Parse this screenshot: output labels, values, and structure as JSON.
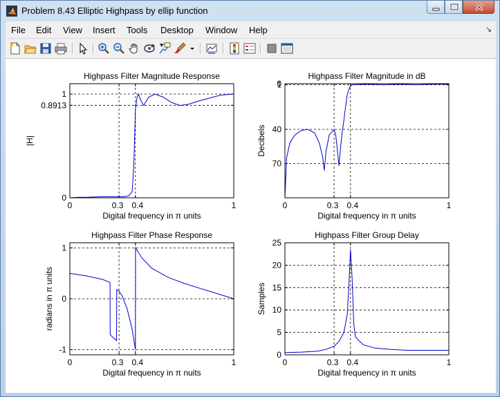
{
  "window": {
    "title": "Problem 8.43 Elliptic Highpass by ellip function"
  },
  "menu": [
    "File",
    "Edit",
    "View",
    "Insert",
    "Tools",
    "Desktop",
    "Window",
    "Help"
  ],
  "menu_overflow": "↘",
  "toolbar_icons": [
    "new-figure-icon",
    "open-file-icon",
    "save-icon",
    "print-icon",
    "edit-plot-icon",
    "zoom-in-icon",
    "zoom-out-icon",
    "pan-icon",
    "rotate-3d-icon",
    "data-cursor-icon",
    "brush-icon",
    "brush-dropdown-icon",
    "link-plot-icon",
    "colorbar-icon",
    "legend-icon",
    "hide-plot-tools-icon",
    "show-plot-tools-icon"
  ],
  "colors": {
    "line": "#0000cc",
    "axes": "#000000",
    "background": "#ffffff"
  },
  "chart_data": [
    {
      "type": "line",
      "title": "Highpass Filter Magnitude Response",
      "xlabel": "Digital frequency in π units",
      "ylabel": "|H|",
      "xlim": [
        0,
        1
      ],
      "ylim": [
        0,
        1.1
      ],
      "xticks": [
        "0",
        "0.3",
        "0.4",
        "1"
      ],
      "xtick_values": [
        0,
        0.3,
        0.4,
        1
      ],
      "yticks": [
        "0",
        "0.8913",
        "1"
      ],
      "ytick_values": [
        0,
        0.8913,
        1
      ],
      "grid": "dashed at ticks",
      "x": [
        0,
        0.05,
        0.1,
        0.15,
        0.2,
        0.25,
        0.3,
        0.33,
        0.36,
        0.38,
        0.39,
        0.4,
        0.41,
        0.42,
        0.43,
        0.45,
        0.48,
        0.52,
        0.57,
        0.62,
        0.67,
        0.72,
        0.78,
        0.85,
        0.92,
        1.0
      ],
      "y": [
        0,
        0.005,
        0.005,
        0.008,
        0.01,
        0.01,
        0.01,
        0.01,
        0.02,
        0.06,
        0.3,
        0.85,
        0.97,
        1.0,
        0.95,
        0.89,
        0.97,
        1.0,
        0.97,
        0.92,
        0.89,
        0.9,
        0.93,
        0.96,
        0.99,
        1.0
      ]
    },
    {
      "type": "line",
      "title": "Highpass Filter Magnitude in dB",
      "xlabel": "Digital frequency in π units",
      "ylabel": "Decibels",
      "xlim": [
        0,
        1
      ],
      "ylim": [
        -100,
        0
      ],
      "y_display": "attenuation axis reversed (0 at top)",
      "xticks": [
        "0",
        "0.3",
        "0.4",
        "1"
      ],
      "xtick_values": [
        0,
        0.3,
        0.4,
        1
      ],
      "yticks": [
        "0",
        "1",
        "40",
        "70"
      ],
      "ytick_values": [
        0,
        1,
        40,
        70
      ],
      "grid": "dashed at ticks",
      "x": [
        0,
        0.01,
        0.03,
        0.06,
        0.1,
        0.14,
        0.18,
        0.21,
        0.23,
        0.24,
        0.25,
        0.27,
        0.3,
        0.31,
        0.33,
        0.34,
        0.35,
        0.36,
        0.37,
        0.38,
        0.39,
        0.4,
        0.41,
        0.5,
        0.6,
        0.7,
        0.8,
        0.9,
        1.0
      ],
      "y": [
        -100,
        -65,
        -52,
        -45,
        -41,
        -40,
        -43,
        -52,
        -64,
        -76,
        -60,
        -45,
        -40,
        -45,
        -72,
        -55,
        -42,
        -32,
        -20,
        -10,
        -5,
        -2,
        -1,
        -0.5,
        -1,
        -0.5,
        -1,
        -0.5,
        -0.5
      ]
    },
    {
      "type": "line",
      "title": "Highpass Filter Phase Response",
      "xlabel": "Digital frequency in π nuits",
      "ylabel": "radians in π units",
      "xlim": [
        0,
        1
      ],
      "ylim": [
        -1.1,
        1.1
      ],
      "xticks": [
        "0",
        "0.3",
        "0.4",
        "1"
      ],
      "xtick_values": [
        0,
        0.3,
        0.4,
        1
      ],
      "yticks": [
        "-1",
        "0",
        "1"
      ],
      "ytick_values": [
        -1,
        0,
        1
      ],
      "grid": "dashed at ticks",
      "x": [
        0,
        0.1,
        0.2,
        0.245,
        0.246,
        0.25,
        0.285,
        0.286,
        0.3,
        0.32,
        0.35,
        0.38,
        0.4,
        0.401,
        0.44,
        0.5,
        0.6,
        0.7,
        0.8,
        0.9,
        1.0
      ],
      "y": [
        0.5,
        0.45,
        0.38,
        0.32,
        -0.7,
        -0.72,
        -0.82,
        0.18,
        0.15,
        0.05,
        -0.2,
        -0.6,
        -1.0,
        1.0,
        0.8,
        0.6,
        0.42,
        0.3,
        0.2,
        0.1,
        0.0
      ]
    },
    {
      "type": "line",
      "title": "Highpass Filter Group Delay",
      "xlabel": "Digital frequency in π units",
      "ylabel": "Samples",
      "xlim": [
        0,
        1
      ],
      "ylim": [
        0,
        25
      ],
      "xticks": [
        "0",
        "0.3",
        "0.4",
        "1"
      ],
      "xtick_values": [
        0,
        0.3,
        0.4,
        1
      ],
      "yticks": [
        "0",
        "5",
        "10",
        "15",
        "20",
        "25"
      ],
      "ytick_values": [
        0,
        5,
        10,
        15,
        20,
        25
      ],
      "grid": "dashed at ticks",
      "x": [
        0,
        0.1,
        0.2,
        0.25,
        0.3,
        0.33,
        0.36,
        0.38,
        0.39,
        0.4,
        0.41,
        0.42,
        0.43,
        0.45,
        0.48,
        0.55,
        0.65,
        0.75,
        0.85,
        1.0
      ],
      "y": [
        0.5,
        0.6,
        0.8,
        1.2,
        1.9,
        3,
        5,
        9,
        15,
        23.5,
        17,
        7,
        4,
        3.2,
        2.2,
        1.5,
        1.2,
        1.0,
        1.0,
        1.0
      ]
    }
  ]
}
